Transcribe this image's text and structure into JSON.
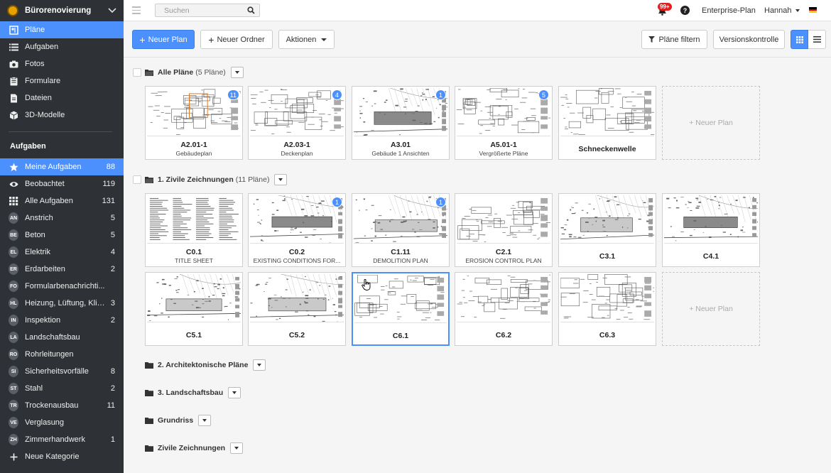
{
  "project": {
    "name": "Bürorenovierung"
  },
  "nav": [
    {
      "label": "Pläne",
      "icon": "plans-icon",
      "active": true
    },
    {
      "label": "Aufgaben",
      "icon": "list-icon"
    },
    {
      "label": "Fotos",
      "icon": "camera-icon"
    },
    {
      "label": "Formulare",
      "icon": "clipboard-icon"
    },
    {
      "label": "Dateien",
      "icon": "file-icon"
    },
    {
      "label": "3D-Modelle",
      "icon": "cube-icon"
    }
  ],
  "tasks_section": {
    "title": "Aufgaben",
    "items": [
      {
        "label": "Meine Aufgaben",
        "count": "88",
        "icon": "star-icon",
        "active": true
      },
      {
        "label": "Beobachtet",
        "count": "119",
        "icon": "eye-icon"
      },
      {
        "label": "Alle Aufgaben",
        "count": "131",
        "icon": "grid-icon"
      },
      {
        "label": "Anstrich",
        "count": "5",
        "abbr": "AN"
      },
      {
        "label": "Beton",
        "count": "5",
        "abbr": "BE"
      },
      {
        "label": "Elektrik",
        "count": "4",
        "abbr": "EL"
      },
      {
        "label": "Erdarbeiten",
        "count": "2",
        "abbr": "ER"
      },
      {
        "label": "Formularbenachrichti...",
        "count": "",
        "abbr": "FO"
      },
      {
        "label": "Heizung, Lüftung, Klima",
        "count": "3",
        "abbr": "HL"
      },
      {
        "label": "Inspektion",
        "count": "2",
        "abbr": "IN"
      },
      {
        "label": "Landschaftsbau",
        "count": "",
        "abbr": "LA"
      },
      {
        "label": "Rohrleitungen",
        "count": "",
        "abbr": "RO"
      },
      {
        "label": "Sicherheitsvorfälle",
        "count": "8",
        "abbr": "SI"
      },
      {
        "label": "Stahl",
        "count": "2",
        "abbr": "ST"
      },
      {
        "label": "Trockenausbau",
        "count": "11",
        "abbr": "TR"
      },
      {
        "label": "Verglasung",
        "count": "",
        "abbr": "VE"
      },
      {
        "label": "Zimmerhandwerk",
        "count": "1",
        "abbr": "ZH"
      },
      {
        "label": "Neue Kategorie",
        "count": "",
        "icon": "plus-icon"
      }
    ]
  },
  "topbar": {
    "search_placeholder": "Suchen",
    "notifications": "99+",
    "help": "?",
    "plan": "Enterprise-Plan",
    "user": "Hannah",
    "flag_colors": [
      "#000000",
      "#dd0000",
      "#ffce00"
    ]
  },
  "toolbar": {
    "new_plan": "Neuer Plan",
    "new_folder": "Neuer Ordner",
    "actions": "Aktionen",
    "filter": "Pläne filtern",
    "versions": "Versionskontrolle"
  },
  "folders": [
    {
      "name": "Alle Pläne",
      "count": "(5 Pläne)",
      "plans": [
        {
          "code": "A2.01-1",
          "desc": "Gebäudeplan",
          "badge": "11"
        },
        {
          "code": "A2.03-1",
          "desc": "Deckenplan",
          "badge": "4"
        },
        {
          "code": "A3.01",
          "desc": "Gebäude 1 Ansichten",
          "badge": "1"
        },
        {
          "code": "A5.01-1",
          "desc": "Vergrößerte Pläne",
          "badge": "5"
        },
        {
          "code": "Schneckenwelle",
          "desc": "",
          "badge": ""
        }
      ],
      "new_plan": "+ Neuer Plan"
    },
    {
      "name": "1. Zivile Zeichnungen",
      "count": "(11 Pläne)",
      "plans": [
        {
          "code": "C0.1",
          "desc": "TITLE SHEET",
          "badge": ""
        },
        {
          "code": "C0.2",
          "desc": "EXISTING CONDITIONS FOR...",
          "badge": "1"
        },
        {
          "code": "C1.11",
          "desc": "DEMOLITION PLAN",
          "badge": "1"
        },
        {
          "code": "C2.1",
          "desc": "EROSION CONTROL PLAN",
          "badge": ""
        },
        {
          "code": "C3.1",
          "desc": "",
          "badge": ""
        },
        {
          "code": "C4.1",
          "desc": "",
          "badge": ""
        },
        {
          "code": "C5.1",
          "desc": "",
          "badge": ""
        },
        {
          "code": "C5.2",
          "desc": "",
          "badge": ""
        },
        {
          "code": "C6.1",
          "desc": "",
          "badge": "",
          "selected": true
        },
        {
          "code": "C6.2",
          "desc": "",
          "badge": ""
        },
        {
          "code": "C6.3",
          "desc": "",
          "badge": ""
        }
      ],
      "new_plan": "+ Neuer Plan"
    },
    {
      "name": "2. Architektonische Pläne",
      "count": ""
    },
    {
      "name": "3. Landschaftsbau",
      "count": ""
    },
    {
      "name": "Grundriss",
      "count": ""
    },
    {
      "name": "Zivile Zeichnungen",
      "count": ""
    }
  ]
}
